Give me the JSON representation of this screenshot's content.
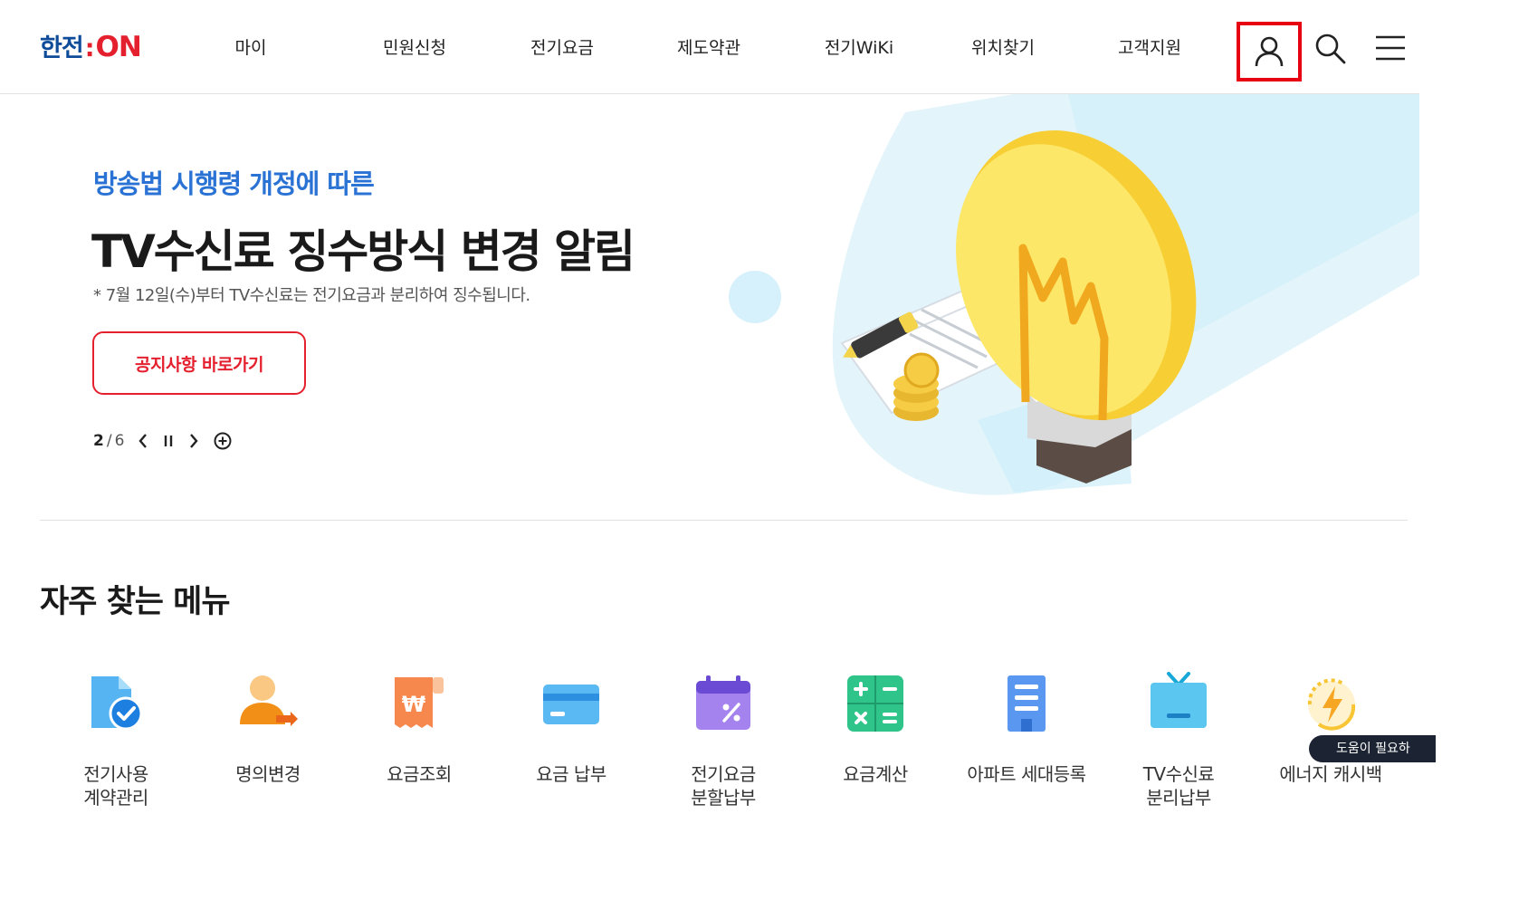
{
  "brand": {
    "logo_korean": "한전",
    "logo_colon": ":",
    "logo_on": "ON",
    "accent_red": "#e5202e",
    "accent_blue": "#2a73d4"
  },
  "nav": {
    "items": [
      {
        "label": "마이"
      },
      {
        "label": "민원신청"
      },
      {
        "label": "전기요금"
      },
      {
        "label": "제도약관"
      },
      {
        "label": "전기WiKi"
      },
      {
        "label": "위치찾기"
      },
      {
        "label": "고객지원"
      }
    ],
    "icons": [
      "user-icon",
      "search-icon",
      "hamburger-menu-icon"
    ]
  },
  "hero": {
    "subtitle": "방송법 시행령 개정에 따른",
    "title": "TV수신료 징수방식 변경 알림",
    "note": "* 7월 12일(수)부터 TV수신료는 전기요금과 분리하여 징수됩니다.",
    "button_label": "공지사항 바로가기",
    "pager_current": "2",
    "pager_sep": "/",
    "pager_total": "6"
  },
  "quick_menu": {
    "title": "자주 찾는 메뉴",
    "items": [
      {
        "label": "전기사용\n계약관리",
        "icon": "document-check-icon"
      },
      {
        "label": "명의변경",
        "icon": "person-transfer-icon"
      },
      {
        "label": "요금조회",
        "icon": "won-receipt-icon"
      },
      {
        "label": "요금 납부",
        "icon": "credit-card-icon"
      },
      {
        "label": "전기요금\n분할납부",
        "icon": "calendar-percent-icon"
      },
      {
        "label": "요금계산",
        "icon": "calculator-icon"
      },
      {
        "label": "아파트 세대등록",
        "icon": "apartment-icon"
      },
      {
        "label": "TV수신료\n분리납부",
        "icon": "tv-icon"
      },
      {
        "label": "에너지 캐시백",
        "icon": "energy-cashback-icon"
      }
    ]
  },
  "help_badge": {
    "label": "도움이 필요하"
  }
}
